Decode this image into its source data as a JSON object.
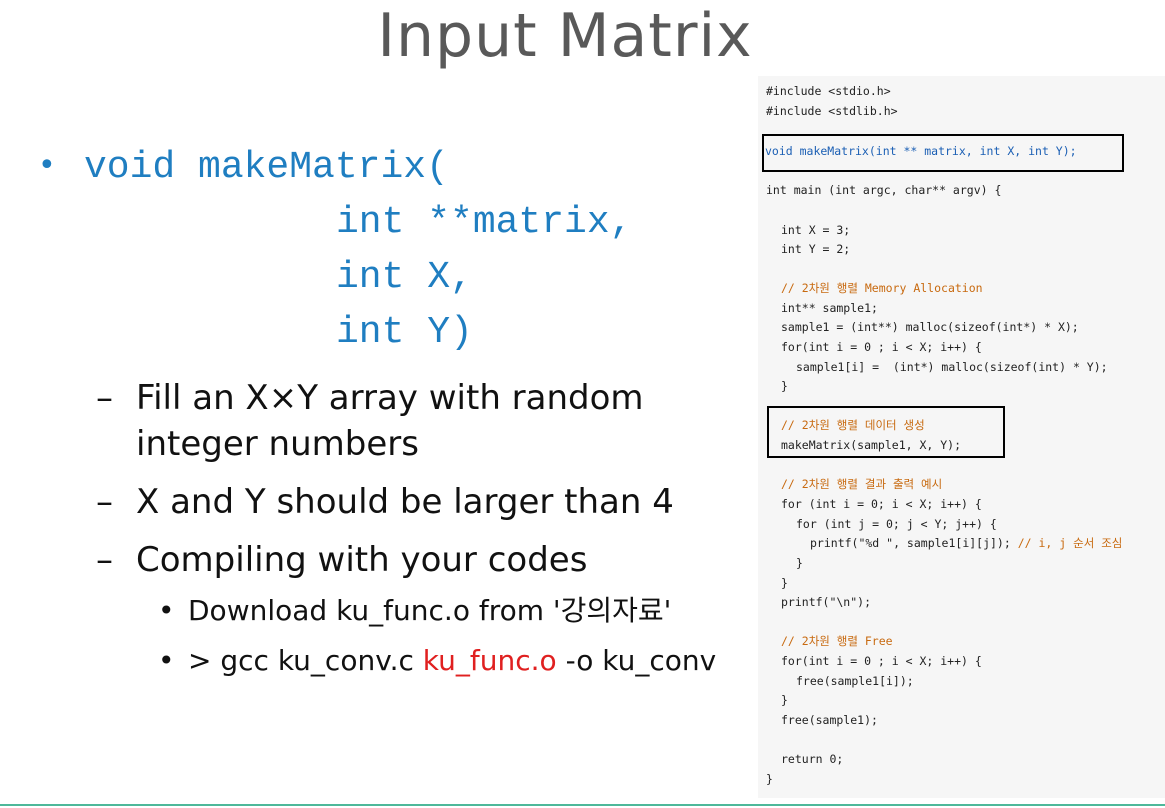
{
  "title": "Input Matrix",
  "main_bullet": {
    "lines": [
      "void makeMatrix(",
      "int **matrix,",
      "int X,",
      "int Y)"
    ]
  },
  "sub_bullets": [
    {
      "dash": "–",
      "lines": [
        "Fill an X×Y array with random",
        "integer numbers"
      ]
    },
    {
      "dash": "–",
      "lines": [
        "X and Y should be larger than 4"
      ]
    },
    {
      "dash": "–",
      "lines": [
        "Compiling with your codes"
      ]
    }
  ],
  "subsub_bullets": [
    {
      "text": "Download ku_func.o from '강의자료'"
    },
    {
      "prefix": "> gcc ku_conv.c ",
      "highlight": "ku_func.o",
      "suffix": " -o ku_conv"
    }
  ],
  "code": {
    "includes": [
      "#include <stdio.h>",
      "#include <stdlib.h>"
    ],
    "decl": "void makeMatrix(int ** matrix, int X, int Y);",
    "main_sig": "int main (int argc, char** argv) {",
    "x_decl": "int X = 3;",
    "y_decl": "int Y = 2;",
    "c_alloc": "// 2차원 행렬 Memory Allocation",
    "sample_decl": "int** sample1;",
    "malloc1": "sample1 = (int**) malloc(sizeof(int*) * X);",
    "for1": "for(int i = 0 ; i < X; i++) {",
    "malloc2": "sample1[i] =  (int*) malloc(sizeof(int) * Y);",
    "close1": "}",
    "c_data": "// 2차원 행렬 데이터 생성",
    "call": "makeMatrix(sample1, X, Y);",
    "c_print": "// 2차원 행렬 결과 출력 예시",
    "for2": "for (int i = 0; i < X; i++) {",
    "for3": "for (int j = 0; j < Y; j++) {",
    "printf1": "printf(\"%d \", sample1[i][j]);",
    "c_order": "// i, j 순서 조심",
    "close2": "}",
    "close3": "}",
    "printf2": "printf(\"\\n\");",
    "c_free": "// 2차원 행렬 Free",
    "for4": "for(int i = 0 ; i < X; i++) {",
    "free1": "free(sample1[i]);",
    "close4": "}",
    "free2": "free(sample1);",
    "ret": "return 0;",
    "close_main": "}"
  }
}
